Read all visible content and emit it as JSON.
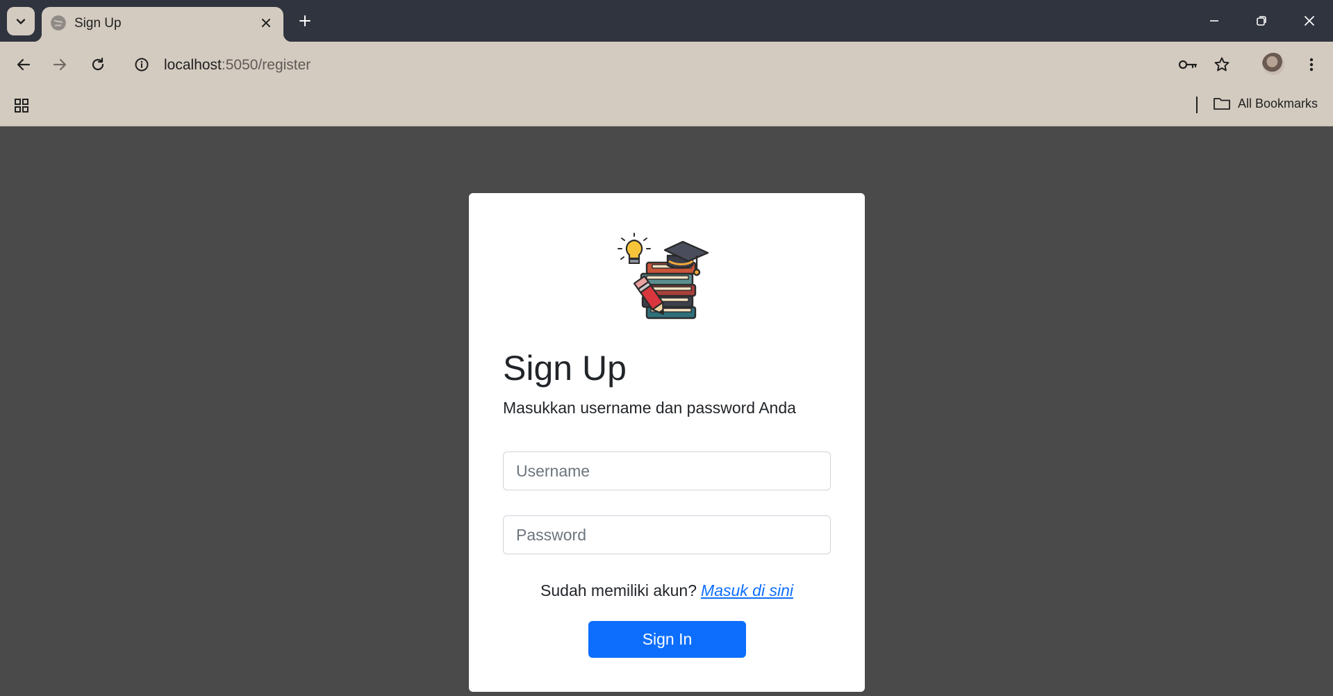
{
  "browser": {
    "tab": {
      "title": "Sign Up",
      "favicon": "globe-icon"
    },
    "url": {
      "host": "localhost",
      "path": ":5050/register"
    },
    "bookmarks": {
      "all_label": "All Bookmarks"
    }
  },
  "page": {
    "heading": "Sign Up",
    "subtitle": "Masukkan username dan password Anda",
    "username_placeholder": "Username",
    "password_placeholder": "Password",
    "login_prompt": "Sudah memiliki akun?",
    "login_link": "Masuk di sini",
    "submit_label": "Sign In",
    "logo": "education-books-logo"
  },
  "colors": {
    "tabstrip": "#30343f",
    "toolbar": "#d4cbc0",
    "page_background": "#4a4a4a",
    "primary": "#0d6efd"
  }
}
